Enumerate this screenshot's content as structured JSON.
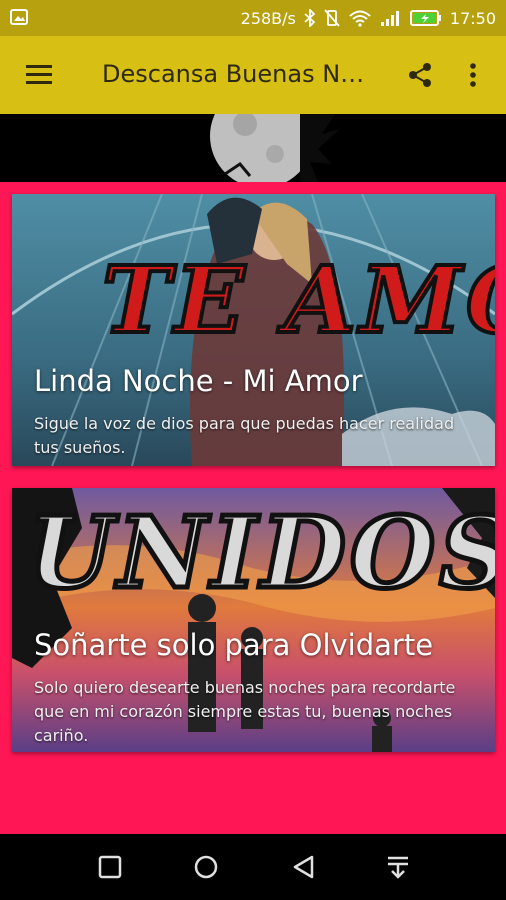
{
  "status_bar": {
    "network_speed": "258B/s",
    "time": "17:50",
    "icons": [
      "gallery-icon",
      "bluetooth-icon",
      "vibrate-off-icon",
      "wifi-icon",
      "signal-icon",
      "battery-charging-icon"
    ]
  },
  "app_bar": {
    "title": "Descansa Buenas Noches Mi Amor",
    "icons": [
      "menu-icon",
      "share-icon",
      "more-vert-icon"
    ]
  },
  "cards": [
    {
      "image_text": "TE AMO",
      "title": "Linda Noche - Mi Amor",
      "description": "Sigue la voz de dios para que puedas hacer realidad tus sueños."
    },
    {
      "image_text": "UNIDOS",
      "title": "Soñarte solo para Olvidarte",
      "description": "Solo quiero desearte buenas noches para recordarte que en mi corazón siempre estas tu, buenas noches cariño."
    }
  ],
  "nav_bar": {
    "icons": [
      "recents-icon",
      "home-icon",
      "back-icon",
      "notification-pull-icon"
    ]
  },
  "colors": {
    "status_bar": "#b8a10f",
    "app_bar": "#d8bf14",
    "background": "#ff1654",
    "nav_bar": "#000000"
  }
}
